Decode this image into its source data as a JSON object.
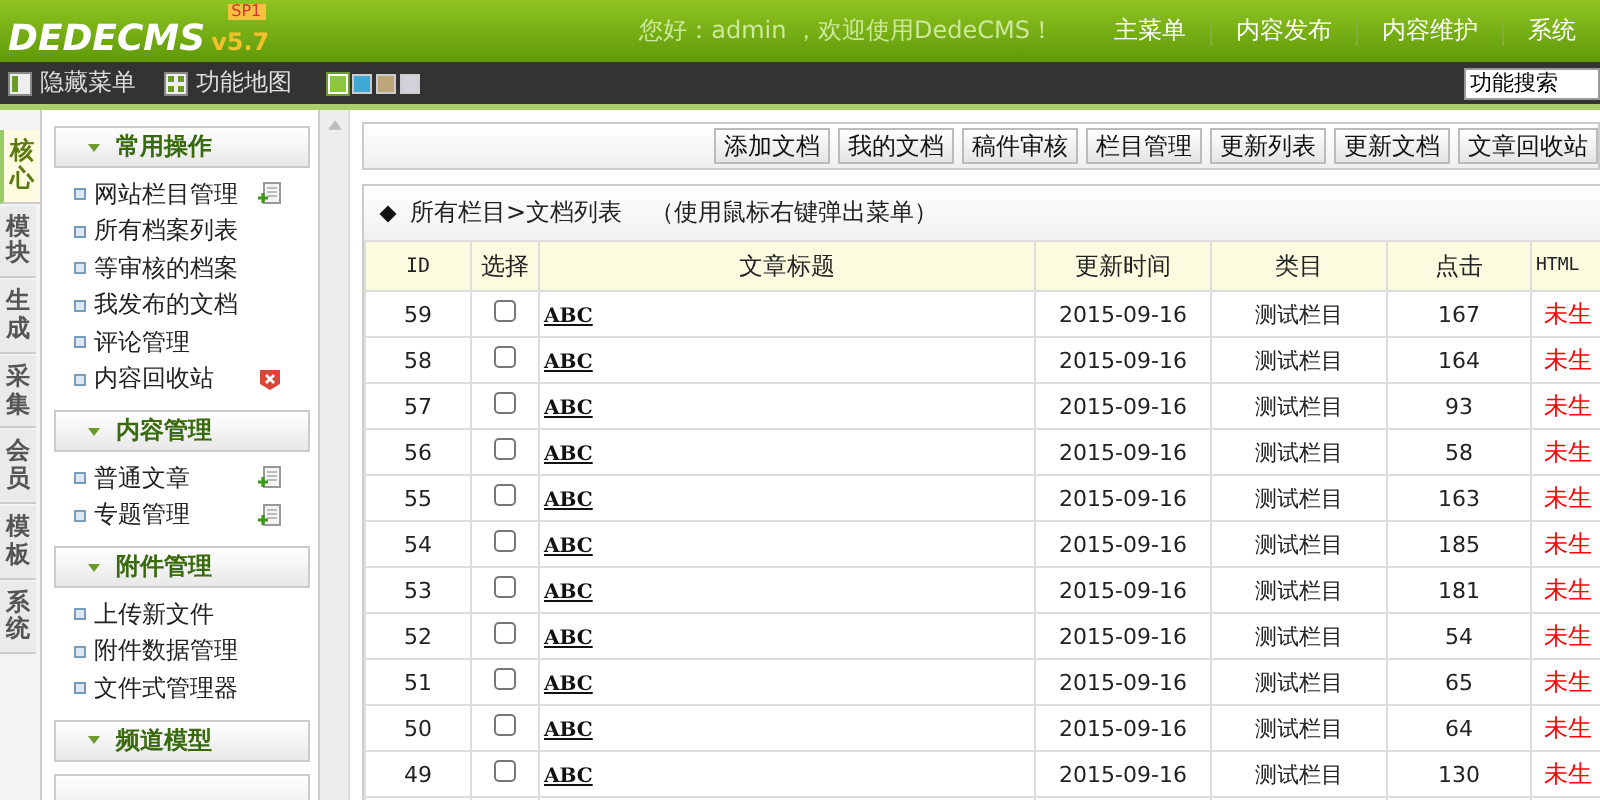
{
  "header": {
    "logo": "DEDECMS",
    "version": "v5.7",
    "badge": "SP1",
    "greeting": "您好：admin ，欢迎使用DedeCMS！",
    "nav": [
      "主菜单",
      "内容发布",
      "内容维护",
      "系统"
    ]
  },
  "toolbar": {
    "hide_menu": "隐藏菜单",
    "site_map": "功能地图",
    "themes": [
      {
        "color": "#8cc63f",
        "selected": true
      },
      {
        "color": "#3fa9d6",
        "selected": false
      },
      {
        "color": "#bfa67a",
        "selected": false
      },
      {
        "color": "#d0d4d8",
        "selected": false
      }
    ],
    "search": {
      "value": "功能搜索"
    }
  },
  "side_tabs": [
    {
      "label": "核心",
      "selected": true
    },
    {
      "label": "模块",
      "selected": false
    },
    {
      "label": "生成",
      "selected": false
    },
    {
      "label": "采集",
      "selected": false
    },
    {
      "label": "会员",
      "selected": false
    },
    {
      "label": "模板",
      "selected": false
    },
    {
      "label": "系统",
      "selected": false
    }
  ],
  "sidebar": [
    {
      "title": "常用操作",
      "items": [
        {
          "label": "网站栏目管理",
          "kind": "add"
        },
        {
          "label": "所有档案列表"
        },
        {
          "label": "等审核的档案"
        },
        {
          "label": "我发布的文档"
        },
        {
          "label": "评论管理"
        },
        {
          "label": "内容回收站",
          "kind": "delete"
        }
      ]
    },
    {
      "title": "内容管理",
      "items": [
        {
          "label": "普通文章",
          "kind": "add"
        },
        {
          "label": "专题管理",
          "kind": "add"
        }
      ]
    },
    {
      "title": "附件管理",
      "items": [
        {
          "label": "上传新文件"
        },
        {
          "label": "附件数据管理"
        },
        {
          "label": "文件式管理器"
        }
      ]
    },
    {
      "title": "频道模型"
    }
  ],
  "actions": [
    "添加文档",
    "我的文档",
    "稿件审核",
    "栏目管理",
    "更新列表",
    "更新文档",
    "文章回收站"
  ],
  "panel": {
    "breadcrumb": "所有栏目>文档列表",
    "hint": "（使用鼠标右键弹出菜单）"
  },
  "table": {
    "columns": [
      "ID",
      "选择",
      "文章标题",
      "更新时间",
      "类目",
      "点击",
      "HTML"
    ],
    "rows": [
      {
        "id": "59",
        "checked": false,
        "title": "ABC",
        "date": "2015-09-16",
        "category": "测试栏目",
        "hits": "167",
        "status": "未生"
      },
      {
        "id": "58",
        "checked": false,
        "title": "ABC",
        "date": "2015-09-16",
        "category": "测试栏目",
        "hits": "164",
        "status": "未生"
      },
      {
        "id": "57",
        "checked": false,
        "title": "ABC",
        "date": "2015-09-16",
        "category": "测试栏目",
        "hits": "93",
        "status": "未生"
      },
      {
        "id": "56",
        "checked": false,
        "title": "ABC",
        "date": "2015-09-16",
        "category": "测试栏目",
        "hits": "58",
        "status": "未生"
      },
      {
        "id": "55",
        "checked": false,
        "title": "ABC",
        "date": "2015-09-16",
        "category": "测试栏目",
        "hits": "163",
        "status": "未生"
      },
      {
        "id": "54",
        "checked": false,
        "title": "ABC",
        "date": "2015-09-16",
        "category": "测试栏目",
        "hits": "185",
        "status": "未生"
      },
      {
        "id": "53",
        "checked": false,
        "title": "ABC",
        "date": "2015-09-16",
        "category": "测试栏目",
        "hits": "181",
        "status": "未生"
      },
      {
        "id": "52",
        "checked": false,
        "title": "ABC",
        "date": "2015-09-16",
        "category": "测试栏目",
        "hits": "54",
        "status": "未生"
      },
      {
        "id": "51",
        "checked": false,
        "title": "ABC",
        "date": "2015-09-16",
        "category": "测试栏目",
        "hits": "65",
        "status": "未生"
      },
      {
        "id": "50",
        "checked": false,
        "title": "ABC",
        "date": "2015-09-16",
        "category": "测试栏目",
        "hits": "64",
        "status": "未生"
      },
      {
        "id": "49",
        "checked": false,
        "title": "ABC",
        "date": "2015-09-16",
        "category": "测试栏目",
        "hits": "130",
        "status": "未生"
      }
    ]
  }
}
